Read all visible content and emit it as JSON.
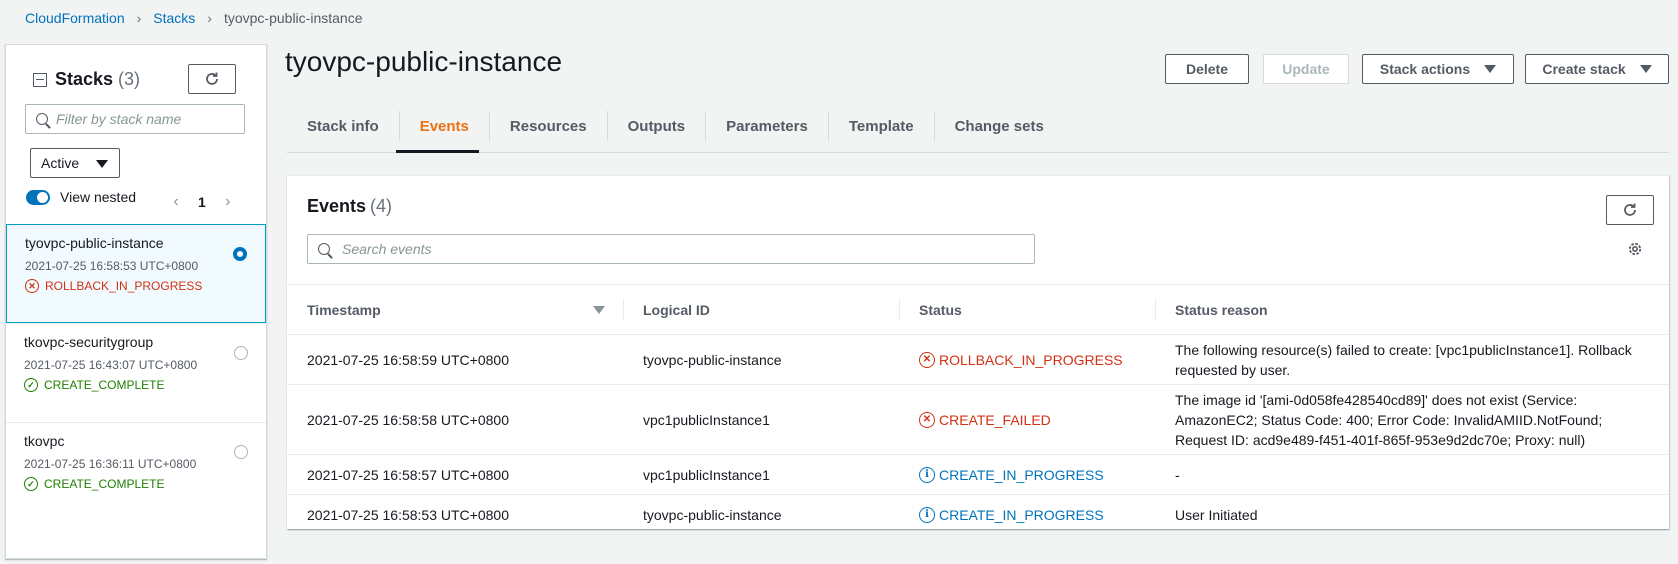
{
  "breadcrumb": {
    "root": "CloudFormation",
    "stacks": "Stacks",
    "current": "tyovpc-public-instance"
  },
  "sidebar": {
    "title": "Stacks",
    "count": "(3)",
    "filter_placeholder": "Filter by stack name",
    "status_filter": "Active",
    "view_nested_label": "View nested",
    "view_nested_on": true,
    "page": "1",
    "prev": "‹",
    "next": "›",
    "stacks": [
      {
        "name": "tyovpc-public-instance",
        "time": "2021-07-25 16:58:53 UTC+0800",
        "status": "ROLLBACK_IN_PROGRESS",
        "kind": "error",
        "selected": true
      },
      {
        "name": "tkovpc-securitygroup",
        "time": "2021-07-25 16:43:07 UTC+0800",
        "status": "CREATE_COMPLETE",
        "kind": "ok",
        "selected": false
      },
      {
        "name": "tkovpc",
        "time": "2021-07-25 16:36:11 UTC+0800",
        "status": "CREATE_COMPLETE",
        "kind": "ok",
        "selected": false
      }
    ]
  },
  "header": {
    "title": "tyovpc-public-instance",
    "buttons": {
      "delete": "Delete",
      "update": "Update",
      "stack_actions": "Stack actions",
      "create_stack": "Create stack"
    }
  },
  "tabs": [
    "Stack info",
    "Events",
    "Resources",
    "Outputs",
    "Parameters",
    "Template",
    "Change sets"
  ],
  "active_tab": "Events",
  "events": {
    "title": "Events",
    "count": "(4)",
    "search_placeholder": "Search events",
    "columns": [
      "Timestamp",
      "Logical ID",
      "Status",
      "Status reason"
    ],
    "rows": [
      {
        "timestamp": "2021-07-25 16:58:59 UTC+0800",
        "logical_id": "tyovpc-public-instance",
        "status": "ROLLBACK_IN_PROGRESS",
        "kind": "error",
        "reason": "The following resource(s) failed to create: [vpc1publicInstance1]. Rollback requested by user."
      },
      {
        "timestamp": "2021-07-25 16:58:58 UTC+0800",
        "logical_id": "vpc1publicInstance1",
        "status": "CREATE_FAILED",
        "kind": "error",
        "reason": "The image id '[ami-0d058fe428540cd89]' does not exist (Service: AmazonEC2; Status Code: 400; Error Code: InvalidAMIID.NotFound; Request ID: acd9e489-f451-401f-865f-953e9d2dc70e; Proxy: null)"
      },
      {
        "timestamp": "2021-07-25 16:58:57 UTC+0800",
        "logical_id": "vpc1publicInstance1",
        "status": "CREATE_IN_PROGRESS",
        "kind": "info",
        "reason": "-"
      },
      {
        "timestamp": "2021-07-25 16:58:53 UTC+0800",
        "logical_id": "tyovpc-public-instance",
        "status": "CREATE_IN_PROGRESS",
        "kind": "info",
        "reason": "User Initiated"
      }
    ]
  },
  "colors": {
    "link": "#0073bb",
    "error": "#d13212",
    "success": "#1d8102",
    "active_tab": "#ec7211"
  }
}
